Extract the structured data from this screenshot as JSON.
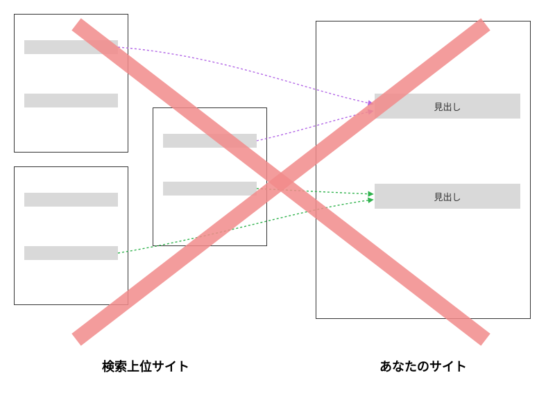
{
  "labels": {
    "left_caption": "検索上位サイト",
    "right_caption": "あなたのサイト",
    "heading_1": "見出し",
    "heading_2": "見出し"
  },
  "colors": {
    "bar_fill": "#d9d9d9",
    "box_border": "#333333",
    "cross_red": "#f28b8b",
    "arrow_purple": "#b266e6",
    "arrow_green": "#2fb24c"
  },
  "chart_data": {
    "type": "diagram",
    "left_group_label": "検索上位サイト",
    "right_group_label": "あなたのサイト",
    "left_sites": [
      {
        "id": "site-top-left",
        "content_bars": 2
      },
      {
        "id": "site-middle",
        "content_bars": 2
      },
      {
        "id": "site-bottom-left",
        "content_bars": 2
      }
    ],
    "right_site": {
      "id": "your-site",
      "headings": [
        "見出し",
        "見出し"
      ]
    },
    "arrows": [
      {
        "color": "purple",
        "from": "site-top-left:bar1",
        "to": "your-site:heading1"
      },
      {
        "color": "purple",
        "from": "site-middle:bar1",
        "to": "your-site:heading1"
      },
      {
        "color": "green",
        "from": "site-middle:bar2",
        "to": "your-site:heading2"
      },
      {
        "color": "green",
        "from": "site-bottom-left:bar2",
        "to": "your-site:heading2"
      }
    ],
    "overlay": "red-cross-rejecting-this-approach"
  }
}
